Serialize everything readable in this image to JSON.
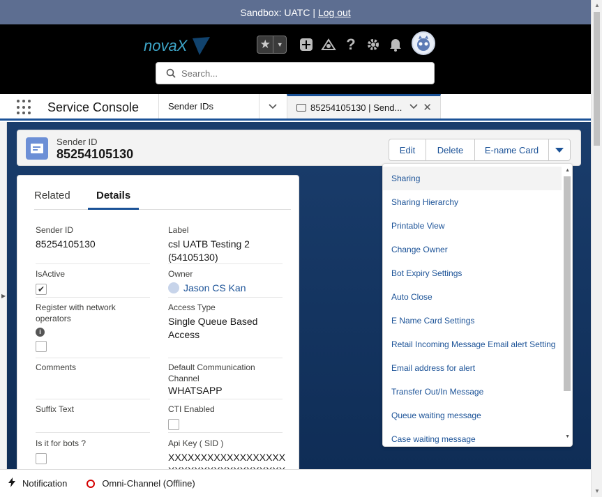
{
  "sandbox": {
    "text": "Sandbox: UATC |",
    "logout": "Log out"
  },
  "header": {
    "logo": "novaX",
    "search_placeholder": "Search...",
    "icons": [
      "favorites-star-icon",
      "add-icon",
      "trailhead-icon",
      "help-icon",
      "setup-gear-icon",
      "notifications-bell-icon"
    ]
  },
  "nav": {
    "app_name": "Service Console",
    "object_selector": "Sender IDs",
    "active_tab": "85254105130 | Send..."
  },
  "record": {
    "type_label": "Sender ID",
    "name": "85254105130",
    "actions": [
      "Edit",
      "Delete",
      "E-name Card"
    ]
  },
  "panel": {
    "tabs": [
      "Related",
      "Details"
    ],
    "active_tab": "Details",
    "fields": {
      "sender_id": {
        "label": "Sender ID",
        "value": "85254105130"
      },
      "label": {
        "label": "Label",
        "value": "csl UATB Testing 2 (54105130)"
      },
      "is_active": {
        "label": "IsActive",
        "checked": true
      },
      "owner": {
        "label": "Owner",
        "value": "Jason CS Kan"
      },
      "register": {
        "label": "Register with network operators",
        "checked": false
      },
      "access_type": {
        "label": "Access Type",
        "value": "Single Queue Based Access"
      },
      "comments": {
        "label": "Comments",
        "value": ""
      },
      "default_channel": {
        "label": "Default Communication Channel",
        "value": "WHATSAPP"
      },
      "suffix_text": {
        "label": "Suffix Text",
        "value": ""
      },
      "cti_enabled": {
        "label": "CTI Enabled",
        "checked": false
      },
      "is_for_bots": {
        "label": "Is it for bots ?",
        "checked": false
      },
      "api_key": {
        "label": "Api Key ( SID )",
        "value": "XXXXXXXXXXXXXXXXXX",
        "value2": "XXXXXXXXXXXXXXXXXX"
      }
    }
  },
  "menu": {
    "items": [
      "Sharing",
      "Sharing Hierarchy",
      "Printable View",
      "Change Owner",
      "Bot Expiry Settings",
      "Auto Close",
      "E Name Card Settings",
      "Retail Incoming Message Email alert Setting",
      "Email address for alert",
      "Transfer Out/In Message",
      "Queue waiting message",
      "Case waiting message"
    ],
    "hovered_index": 0
  },
  "footer": {
    "notification": "Notification",
    "omni_channel": "Omni-Channel (Offline)"
  },
  "colors": {
    "brand": "#1b5297",
    "header": "#000000",
    "sandbox": "#5d6e91",
    "offline": "#d40000"
  }
}
